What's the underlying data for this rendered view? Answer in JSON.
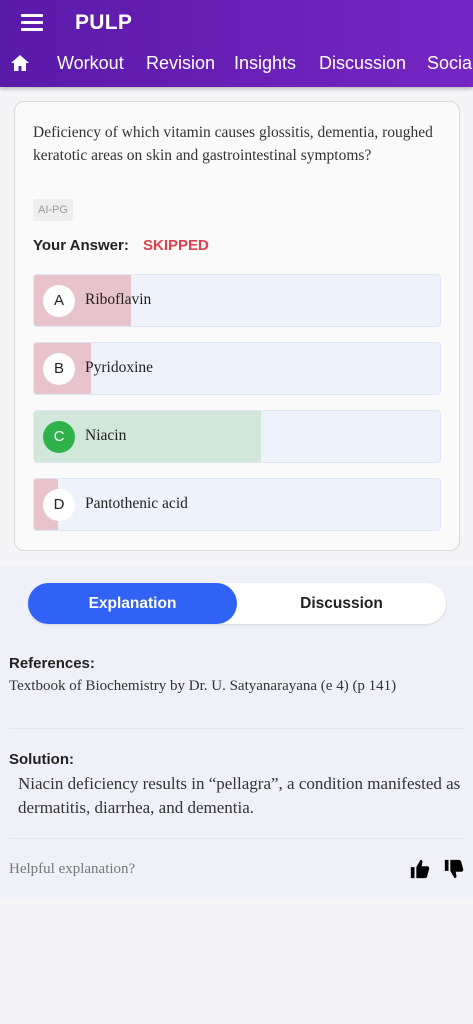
{
  "app": {
    "title": "PULP"
  },
  "icons": {
    "menu": "hamburger-menu-icon",
    "home": "home-icon",
    "like": "thumbs-up-icon",
    "dislike": "thumbs-down-icon"
  },
  "nav": {
    "tabs": [
      "Workout",
      "Revision",
      "Insights",
      "Discussion",
      "Social"
    ]
  },
  "question": {
    "text": "Deficiency of which vitamin causes glossitis, dementia, roughed keratotic areas on skin and gastrointestinal symptoms?",
    "tag": "AI-PG",
    "your_answer_label": "Your Answer:",
    "your_answer_value": "SKIPPED",
    "options": [
      {
        "letter": "A",
        "text": "Riboflavin",
        "share": 0.24,
        "correct": false
      },
      {
        "letter": "B",
        "text": "Pyridoxine",
        "share": 0.14,
        "correct": false
      },
      {
        "letter": "C",
        "text": "Niacin",
        "share": 0.56,
        "correct": true
      },
      {
        "letter": "D",
        "text": "Pantothenic acid",
        "share": 0.06,
        "correct": false
      }
    ]
  },
  "colors": {
    "header": "#6a21b8",
    "accent": "#2f62f5",
    "skipped": "#e0414f",
    "wrong_fill": "#e8c3cc",
    "correct_fill": "#d1e7d9",
    "correct_badge": "#2fb24b"
  },
  "tabs_lower": {
    "explanation": "Explanation",
    "discussion": "Discussion"
  },
  "references": {
    "label": "References:",
    "text": "Textbook of Biochemistry by Dr. U. Satyanarayana (e 4) (p 141)"
  },
  "solution": {
    "label": "Solution:",
    "text": "Niacin deficiency results in “pellagra”, a condition manifested as dermatitis, diarrhea, and dementia."
  },
  "feedback": {
    "prompt": "Helpful explanation?"
  }
}
